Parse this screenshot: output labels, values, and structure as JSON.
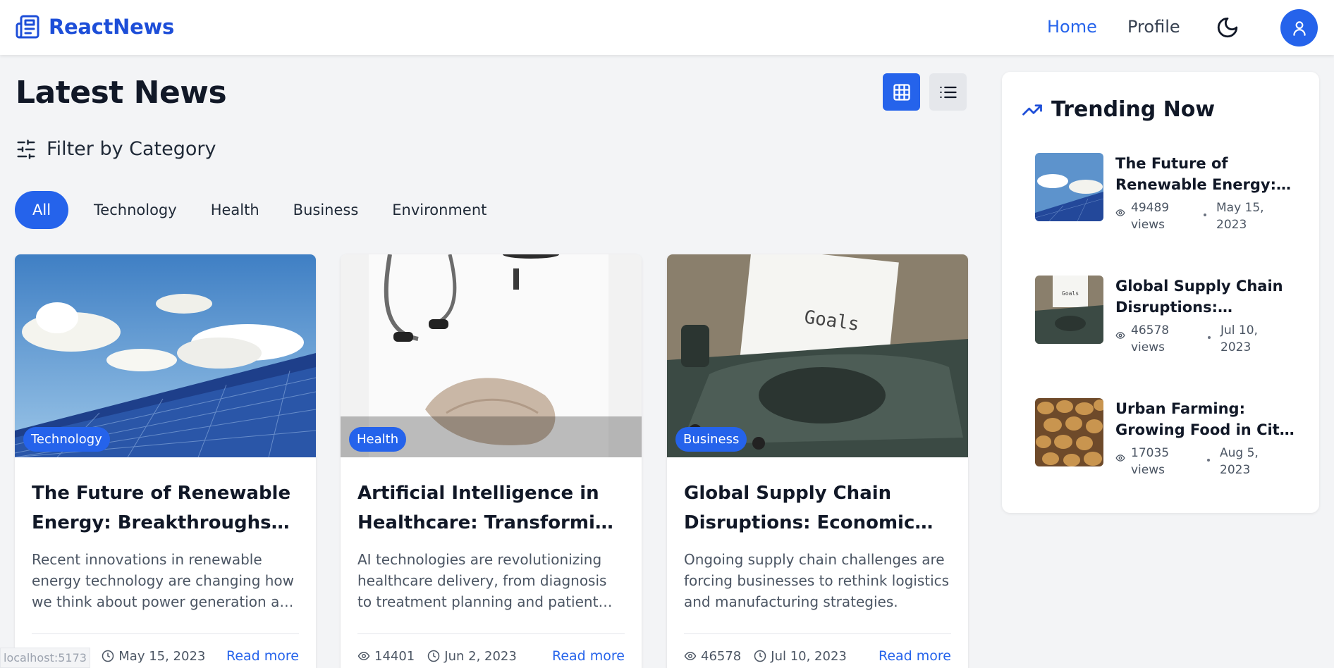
{
  "navbar": {
    "brand": "ReactNews",
    "links": [
      {
        "label": "Home",
        "active": true
      },
      {
        "label": "Profile",
        "active": false
      }
    ],
    "accent": "#2563eb"
  },
  "main": {
    "title": "Latest News",
    "view_modes": [
      "grid",
      "list"
    ],
    "active_view": "grid",
    "filter_label": "Filter by Category",
    "categories": [
      {
        "label": "All",
        "active": true
      },
      {
        "label": "Technology",
        "active": false
      },
      {
        "label": "Health",
        "active": false
      },
      {
        "label": "Business",
        "active": false
      },
      {
        "label": "Environment",
        "active": false
      }
    ],
    "articles": [
      {
        "category": "Technology",
        "title": "The Future of Renewable Energy: Breakthroughs and Innovations",
        "description": "Recent innovations in renewable energy technology are changing how we think about power generation and consumption.",
        "views": "49489",
        "date": "May 15, 2023",
        "read_more": "Read more",
        "image": "solar-panels"
      },
      {
        "category": "Health",
        "title": "Artificial Intelligence in Healthcare: Transforming Patient Care",
        "description": "AI technologies are revolutionizing healthcare delivery, from diagnosis to treatment planning and patient monitoring.",
        "views": "14401",
        "date": "Jun 2, 2023",
        "read_more": "Read more",
        "image": "doctor"
      },
      {
        "category": "Business",
        "title": "Global Supply Chain Disruptions: Economic Impacts",
        "description": "Ongoing supply chain challenges are forcing businesses to rethink logistics and manufacturing strategies.",
        "views": "46578",
        "date": "Jul 10, 2023",
        "read_more": "Read more",
        "image": "typewriter"
      }
    ]
  },
  "trending": {
    "title": "Trending Now",
    "items": [
      {
        "title": "The Future of Renewable Energy: Breakthroughs and Innovations",
        "views": "49489",
        "views_unit": "views",
        "date_line1": "May 15,",
        "date_line2": "2023",
        "image": "solar-panels"
      },
      {
        "title": "Global Supply Chain Disruptions: Economic Impacts",
        "views": "46578",
        "views_unit": "views",
        "date_line1": "Jul 10,",
        "date_line2": "2023",
        "image": "typewriter"
      },
      {
        "title": "Urban Farming: Growing Food in City Spaces",
        "views": "17035",
        "views_unit": "views",
        "date_line1": "Aug 5,",
        "date_line2": "2023",
        "image": "potatoes"
      }
    ]
  },
  "status_bar": {
    "url": "localhost:5173"
  }
}
